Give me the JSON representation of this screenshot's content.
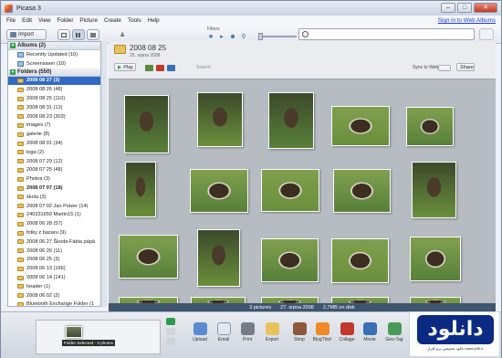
{
  "window": {
    "title": "Picasa 3"
  },
  "menu": {
    "items": [
      "File",
      "Edit",
      "View",
      "Folder",
      "Picture",
      "Create",
      "Tools",
      "Help"
    ],
    "sign_in": "Sign in to Web Albums"
  },
  "toolbar": {
    "import_label": "Import",
    "filters_label": "Filters"
  },
  "sidebar": {
    "albums_header": "Albums (2)",
    "albums": [
      "Recently Updated (10)",
      "Screensaver (10)"
    ],
    "folders_header": "Folders (550)",
    "folders": [
      {
        "label": "2008 08 27 (3)",
        "selected": true,
        "bold": true
      },
      {
        "label": "2008 08 26 (48)"
      },
      {
        "label": "2008 08 25 (110)"
      },
      {
        "label": "2008 08 31 (12)"
      },
      {
        "label": "2008 08 23 (303)"
      },
      {
        "label": "images (7)"
      },
      {
        "label": "galerie (8)"
      },
      {
        "label": "2008 08 01 (34)"
      },
      {
        "label": "loga (2)"
      },
      {
        "label": "2008 07 29 (12)"
      },
      {
        "label": "2008 07 25 (48)"
      },
      {
        "label": "Photos (3)"
      },
      {
        "label": "2008 07 07 (18)",
        "bold": true
      },
      {
        "label": "škola (3)"
      },
      {
        "label": "2008 07 02 Jan Polzer (14)"
      },
      {
        "label": "240331650 Martin15 (1)"
      },
      {
        "label": "2008 06 28 (57)"
      },
      {
        "label": "fotky z bazaru (9)"
      },
      {
        "label": "2008 06 27 Škoda Fabia pápá"
      },
      {
        "label": "2008 06 26 (11)"
      },
      {
        "label": "2008 06 25 (3)"
      },
      {
        "label": "2008 06 13 (166)"
      },
      {
        "label": "2008 06 14 (141)"
      },
      {
        "label": "header (1)"
      },
      {
        "label": "2008 06 02 (2)"
      },
      {
        "label": "Bluetooth Exchange Folder (1"
      }
    ]
  },
  "folder_view": {
    "title": "2008 08 25",
    "date": "25. srpna 2008",
    "play_label": "Play",
    "search_hint": "Search",
    "sync_label": "Sync to Web",
    "share_label": "Share"
  },
  "status": {
    "pictures": "3 pictures",
    "date": "27. srpna 2008",
    "size": "2,7MB on disk"
  },
  "tray": {
    "holder_label": "Folder Selected - 3 photos",
    "actions": [
      "Upload",
      "Email",
      "Print",
      "Export",
      "Shop",
      "BlogThis!",
      "Collage",
      "Movie",
      "Geo-Tag"
    ]
  },
  "watermark": {
    "logo_text": "دانلود",
    "subtitle": "دانلود تخصصی نرم افزار www.p30.ir"
  },
  "colors": {
    "selection": "#316ac5",
    "statusbar": "#3f5570",
    "accent_link": "#1a3fd1"
  }
}
